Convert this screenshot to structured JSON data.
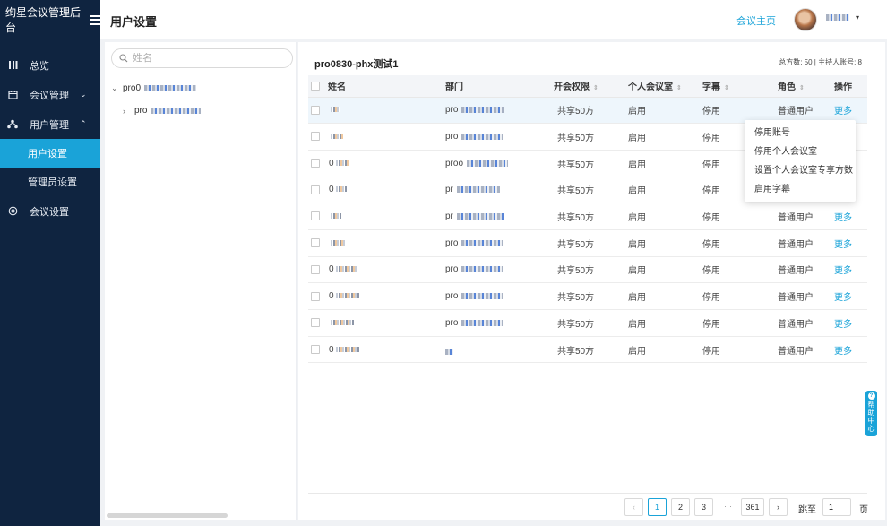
{
  "app": {
    "brand": "绚星会议管理后台"
  },
  "sidebar": {
    "items": [
      {
        "label": "总览",
        "icon": "grid-icon"
      },
      {
        "label": "会议管理",
        "icon": "calendar-icon",
        "chevron": "⌄"
      },
      {
        "label": "用户管理",
        "icon": "org-icon",
        "chevron": "⌃"
      },
      {
        "label": "用户设置",
        "sub": true,
        "active": true
      },
      {
        "label": "管理员设置",
        "sub": true
      },
      {
        "label": "会议设置",
        "icon": "settings-icon"
      }
    ]
  },
  "header": {
    "title": "用户设置",
    "home_link": "会议主页",
    "user_caret": "▾"
  },
  "tree": {
    "search_placeholder": "姓名",
    "root_label": "pro0",
    "child_label": "pro"
  },
  "main": {
    "group_title": "pro0830-phx测试1",
    "stats": "总方数: 50 | 主持人账号: 8",
    "columns": [
      "姓名",
      "部门",
      "开会权限",
      "个人会议室",
      "字幕",
      "角色",
      "操作"
    ],
    "rows": [
      {
        "name": "",
        "dept": "pro",
        "perm": "共享50方",
        "room": "启用",
        "subtitle": "停用",
        "role": "普通用户",
        "op": "更多"
      },
      {
        "name": "",
        "dept": "pro",
        "perm": "共享50方",
        "room": "启用",
        "subtitle": "停用",
        "role": "",
        "op": ""
      },
      {
        "name": "0",
        "dept": "proo",
        "perm": "共享50方",
        "room": "启用",
        "subtitle": "停用",
        "role": "",
        "op": ""
      },
      {
        "name": "0",
        "dept": "pr",
        "perm": "共享50方",
        "room": "启用",
        "subtitle": "停用",
        "role": "",
        "op": ""
      },
      {
        "name": "",
        "dept": "pr",
        "perm": "共享50方",
        "room": "启用",
        "subtitle": "停用",
        "role": "普通用户",
        "op": "更多"
      },
      {
        "name": "",
        "dept": "pro",
        "perm": "共享50方",
        "room": "启用",
        "subtitle": "停用",
        "role": "普通用户",
        "op": "更多"
      },
      {
        "name": "0",
        "dept": "pro",
        "perm": "共享50方",
        "room": "启用",
        "subtitle": "停用",
        "role": "普通用户",
        "op": "更多"
      },
      {
        "name": "0",
        "dept": "pro",
        "perm": "共享50方",
        "room": "启用",
        "subtitle": "停用",
        "role": "普通用户",
        "op": "更多"
      },
      {
        "name": "",
        "dept": "pro",
        "perm": "共享50方",
        "room": "启用",
        "subtitle": "停用",
        "role": "普通用户",
        "op": "更多"
      },
      {
        "name": "0",
        "dept": "",
        "perm": "共享50方",
        "room": "启用",
        "subtitle": "停用",
        "role": "普通用户",
        "op": "更多"
      }
    ],
    "dropdown": [
      "停用账号",
      "停用个人会议室",
      "设置个人会议室专享方数",
      "启用字幕"
    ]
  },
  "pagination": {
    "prev": "‹",
    "pages": [
      "1",
      "2",
      "3"
    ],
    "ellipsis": "···",
    "last": "361",
    "next": "›",
    "current": "1",
    "jump_label": "跳至",
    "jump_value": "1",
    "page_suffix": "页"
  },
  "help": {
    "label": "帮助中心",
    "icon": "?"
  },
  "colors": {
    "sidebar_bg": "#0f2440",
    "accent": "#1aa3d8"
  }
}
